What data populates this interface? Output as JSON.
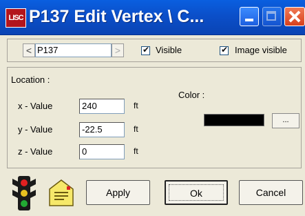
{
  "window": {
    "app_icon_text": "LISC",
    "title": "P137 Edit Vertex \\ C..."
  },
  "nav": {
    "prev_label": "<",
    "next_label": ">",
    "vertex_name": "P137",
    "visible_label": "Visible",
    "visible_checked": true,
    "image_visible_label": "Image visible",
    "image_visible_checked": true
  },
  "location": {
    "title": "Location :",
    "x_label": "x - Value",
    "x_value": "240",
    "y_label": "y - Value",
    "y_value": "-22.5",
    "z_label": "z - Value",
    "z_value": "0",
    "unit": "ft"
  },
  "color": {
    "label": "Color :",
    "swatch_hex": "#000000",
    "browse_label": "..."
  },
  "buttons": {
    "apply": "Apply",
    "ok": "Ok",
    "cancel": "Cancel"
  },
  "icons": {
    "traffic": "traffic-light-icon",
    "note": "note-icon"
  }
}
